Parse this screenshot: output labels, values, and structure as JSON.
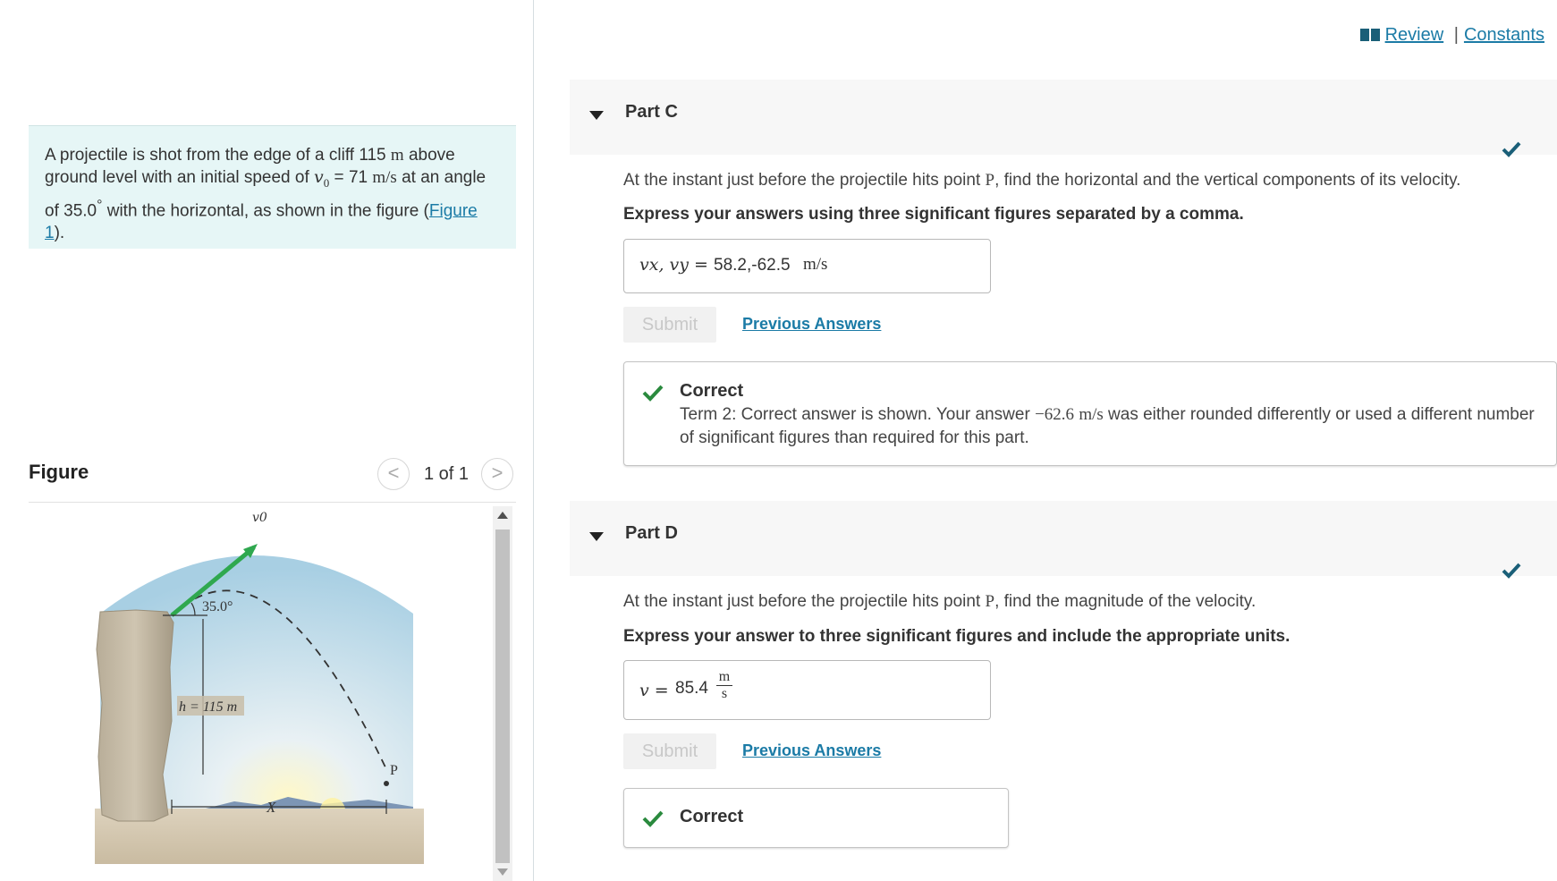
{
  "top_links": {
    "review": "Review",
    "separator": "|",
    "constants": "Constants"
  },
  "problem": {
    "text_1": "A projectile is shot from the edge of a cliff 115",
    "unit_m": "m",
    "text_2": "above ground level with an initial speed of",
    "v0_symbol": "v",
    "v0_sub": "0",
    "eq": "=",
    "v0_value": "71",
    "speed_unit": "m/s",
    "text_3": "at an angle of 35.0",
    "degree": "°",
    "text_4": "with the horizontal, as shown in the figure (",
    "figure_link": "Figure 1",
    "text_5": ")."
  },
  "figure": {
    "title": "Figure",
    "pager": "1 of 1",
    "prev": "<",
    "next": ">",
    "labels": {
      "v0": "v0",
      "angle": "35.0°",
      "height": "h = 115 m",
      "range": "X",
      "point": "P"
    }
  },
  "part_c": {
    "title": "Part C",
    "question_1": "At the instant just before the projectile hits point",
    "point": "P",
    "question_2": ", find the horizontal and the vertical components of its velocity.",
    "instruction": "Express your answers using three significant figures separated by a comma.",
    "answer_label": "vx, vy =",
    "answer_value": "58.2,-62.5",
    "answer_unit": "m/s",
    "submit": "Submit",
    "previous_answers": "Previous Answers",
    "feedback_title": "Correct",
    "feedback_text_1": "Term 2: Correct answer is shown. Your answer",
    "feedback_value": "−62.6",
    "feedback_unit": "m/s",
    "feedback_text_2": "was either rounded differently or used a different number of significant figures than required for this part."
  },
  "part_d": {
    "title": "Part D",
    "question_1": "At the instant just before the projectile hits point",
    "point": "P",
    "question_2": ", find the magnitude of the velocity.",
    "instruction": "Express your answer to three significant figures and include the appropriate units.",
    "answer_label": "v =",
    "answer_value": "85.4",
    "unit_num": "m",
    "unit_den": "s",
    "submit": "Submit",
    "previous_answers": "Previous Answers",
    "feedback_title": "Correct"
  },
  "colors": {
    "accent": "#1b7ba6",
    "correct_green": "#2a8a3e",
    "problem_bg": "#e6f6f6",
    "check_teal": "#1a5f78"
  }
}
